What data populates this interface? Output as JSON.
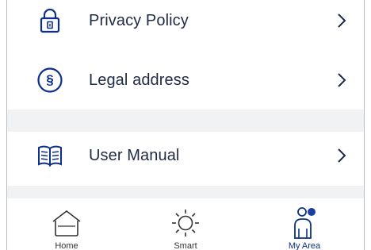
{
  "menu": {
    "items": [
      {
        "label": "Privacy Policy",
        "icon": "lock-icon"
      },
      {
        "label": "Legal address",
        "icon": "section-sign-icon",
        "icon_glyph": "§"
      },
      {
        "label": "User Manual",
        "icon": "book-icon"
      }
    ]
  },
  "bottom_nav": {
    "items": [
      {
        "label": "Home",
        "icon": "home-icon",
        "active": false
      },
      {
        "label": "Smart",
        "icon": "sun-icon",
        "active": false
      },
      {
        "label": "My Area",
        "icon": "user-area-icon",
        "active": true
      }
    ]
  },
  "colors": {
    "accent": "#0b2f8a",
    "text": "#1f2a44",
    "separator": "#f1f2f4",
    "status_dot": "#1a3fa0"
  }
}
